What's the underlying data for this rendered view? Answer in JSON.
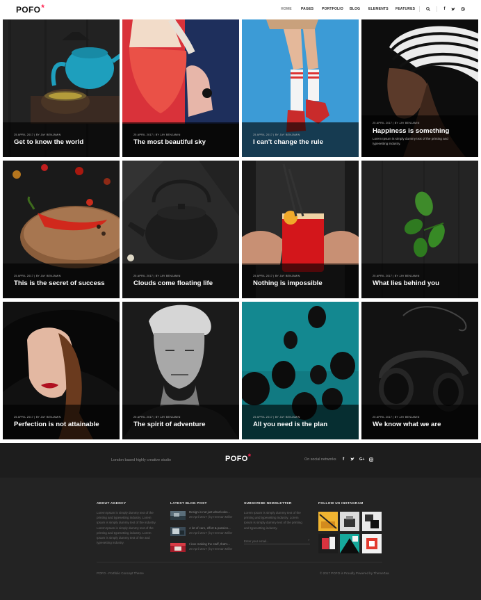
{
  "header": {
    "logo_text": "POFO",
    "logo_mark": "*",
    "nav": [
      "HOME",
      "PAGES",
      "PORTFOLIO",
      "BLOG",
      "ELEMENTS",
      "FEATURES"
    ],
    "icons": [
      "search-icon",
      "facebook-icon",
      "twitter-icon",
      "dribbble-icon"
    ]
  },
  "tiles": [
    {
      "meta": "25 APRIL 2017 | BY JAY BENJAMIN",
      "title": "Get to know the world"
    },
    {
      "meta": "25 APRIL 2017 | BY JAY BENJAMIN",
      "title": "The most beautiful sky"
    },
    {
      "meta": "25 APRIL 2017 | BY JAY BENJAMIN",
      "title": "I can't change the rule"
    },
    {
      "meta": "25 APRIL 2017 | BY JAY BENJAMIN",
      "title": "Happiness is something",
      "excerpt": "Lorem Ipsum is simply dummy text of the printing and typesetting industry."
    },
    {
      "meta": "25 APRIL 2017 | BY JAY BENJAMIN",
      "title": "This is the secret of success"
    },
    {
      "meta": "25 APRIL 2017 | BY JAY BENJAMIN",
      "title": "Clouds come floating life"
    },
    {
      "meta": "25 APRIL 2017 | BY JAY BENJAMIN",
      "title": "Nothing is impossible"
    },
    {
      "meta": "25 APRIL 2017 | BY JAY BENJAMIN",
      "title": "What lies behind you"
    },
    {
      "meta": "25 APRIL 2017 | BY JAY BENJAMIN",
      "title": "Perfection is not attainable"
    },
    {
      "meta": "25 APRIL 2017 | BY JAY BENJAMIN",
      "title": "The spirit of adventure"
    },
    {
      "meta": "25 APRIL 2017 | BY JAY BENJAMIN",
      "title": "All you need is the plan"
    },
    {
      "meta": "25 APRIL 2017 | BY JAY BENJAMIN",
      "title": "We know what we are"
    }
  ],
  "footer_top": {
    "tagline": "London based highly creative studio",
    "logo_text": "POFO",
    "logo_mark": "*",
    "social_label": "On social networks",
    "social": [
      "f",
      "t",
      "G+",
      "ig"
    ]
  },
  "footer": {
    "about": {
      "title": "ABOUT AGENCY",
      "lines": [
        "Lorem Ipsum is simply dummy text of the",
        "printing and typesetting industry. Lorem",
        "Ipsum is simply dummy text of the industry.",
        "Lorem Ipsum is simply dummy text of the",
        "printing and typesetting industry. Lorem",
        "Ipsum is simply dummy text of the and",
        "typesetting industry."
      ]
    },
    "blog": {
      "title": "LATEST BLOG POST",
      "posts": [
        {
          "title": "Design is not just what looks...",
          "date": "20 April 2017 | by Herman Miller"
        },
        {
          "title": "A lot of care, effort & passion...",
          "date": "20 April 2017 | by Herman Miller"
        },
        {
          "title": "I love making the stuff, that's...",
          "date": "20 April 2017 | by Herman Miller"
        }
      ]
    },
    "newsletter": {
      "title": "SUBSCRIBE NEWSLETTER",
      "lines": [
        "Lorem Ipsum is simply dummy text of the",
        "printing and typesetting industry. Lorem",
        "Ipsum is simply dummy text of the printing",
        "and typesetting industry."
      ],
      "placeholder": "Enter your email..."
    },
    "instagram": {
      "title": "FOLLOW US INSTAGRAM"
    },
    "copy_left": "POFO - Portfolio Concept Theme",
    "copy_right": "© 2017 POFO is Proudly Powered by ThemeZaa"
  },
  "colors": {
    "accent": "#ff214f",
    "footer_dark": "#1d1d1d",
    "footer_main": "#232323"
  }
}
